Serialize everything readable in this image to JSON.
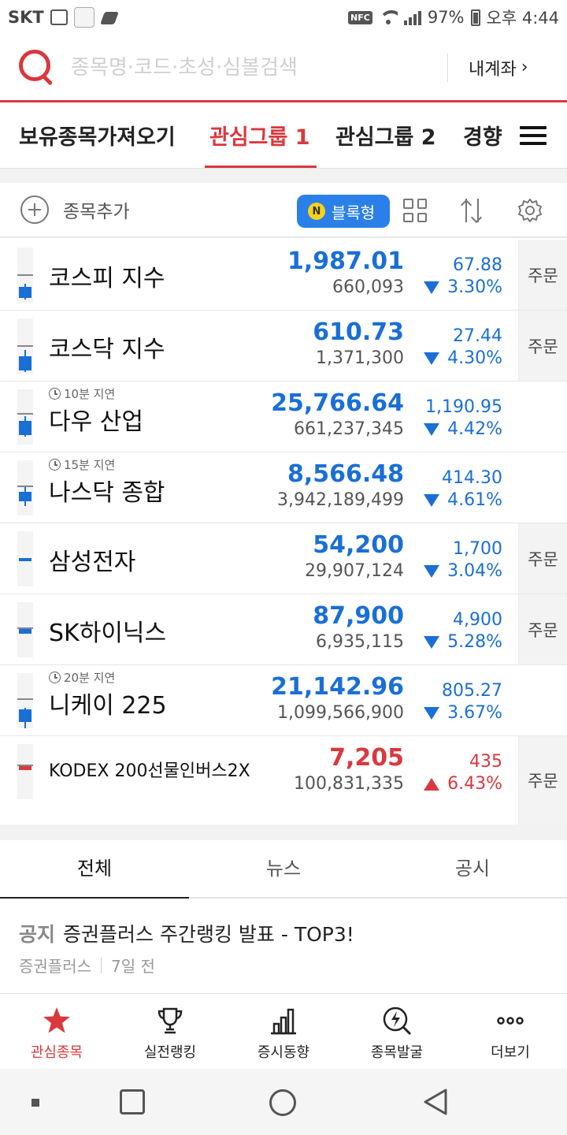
{
  "status_bar": {
    "carrier": "SKT",
    "battery": "97%",
    "time": "오후 4:44",
    "nfc": "NFC",
    "icons": [
      "image-icon",
      "app-icon",
      "shoe-icon",
      "nfc-icon",
      "wifi-icon",
      "signal-icon",
      "battery-icon"
    ]
  },
  "search": {
    "placeholder": "종목명·코드·초성·심볼검색",
    "my_account": "내계좌",
    "my_account_chevron": "›"
  },
  "group_tabs": {
    "items": [
      "보유종목가져오기",
      "관심그룹 1",
      "관심그룹 2",
      "경향"
    ],
    "active_index": 1
  },
  "toolbar": {
    "add_label": "종목추가",
    "block_label": "블록형",
    "n_badge": "N"
  },
  "stocks": [
    {
      "name": "코스피 지수",
      "delay": "",
      "price": "1,987.01",
      "volume": "660,093",
      "change": "67.88",
      "rate": "3.30%",
      "direction": "down",
      "order": "주문"
    },
    {
      "name": "코스닥 지수",
      "delay": "",
      "price": "610.73",
      "volume": "1,371,300",
      "change": "27.44",
      "rate": "4.30%",
      "direction": "down",
      "order": "주문"
    },
    {
      "name": "다우 산업",
      "delay": "10분 지연",
      "price": "25,766.64",
      "volume": "661,237,345",
      "change": "1,190.95",
      "rate": "4.42%",
      "direction": "down",
      "order": ""
    },
    {
      "name": "나스닥 종합",
      "delay": "15분 지연",
      "price": "8,566.48",
      "volume": "3,942,189,499",
      "change": "414.30",
      "rate": "4.61%",
      "direction": "down",
      "order": ""
    },
    {
      "name": "삼성전자",
      "delay": "",
      "price": "54,200",
      "volume": "29,907,124",
      "change": "1,700",
      "rate": "3.04%",
      "direction": "down",
      "order": "주문"
    },
    {
      "name": "SK하이닉스",
      "delay": "",
      "price": "87,900",
      "volume": "6,935,115",
      "change": "4,900",
      "rate": "5.28%",
      "direction": "down",
      "order": "주문"
    },
    {
      "name": "니케이 225",
      "delay": "20분 지연",
      "price": "21,142.96",
      "volume": "1,099,566,900",
      "change": "805.27",
      "rate": "3.67%",
      "direction": "down",
      "order": ""
    },
    {
      "name": "KODEX 200선물인버스2X",
      "delay": "",
      "price": "7,205",
      "volume": "100,831,335",
      "change": "435",
      "rate": "6.43%",
      "direction": "up",
      "order": "주문"
    }
  ],
  "news_tabs": {
    "items": [
      "전체",
      "뉴스",
      "공시"
    ],
    "active_index": 0
  },
  "notice": {
    "tag": "공지",
    "title": "증권플러스 주간랭킹 발표 - TOP3!",
    "source": "증권플러스",
    "time": "7일 전"
  },
  "bottom_nav": {
    "items": [
      {
        "label": "관심종목",
        "icon": "star-icon"
      },
      {
        "label": "실전랭킹",
        "icon": "trophy-icon"
      },
      {
        "label": "증시동향",
        "icon": "bar-chart-icon"
      },
      {
        "label": "종목발굴",
        "icon": "lightning-search-icon"
      },
      {
        "label": "더보기",
        "icon": "more-icon"
      }
    ],
    "active_index": 0
  },
  "colors": {
    "brand_red": "#d9383e",
    "down_blue": "#1a6fd6",
    "block_blue": "#2a80e8"
  }
}
